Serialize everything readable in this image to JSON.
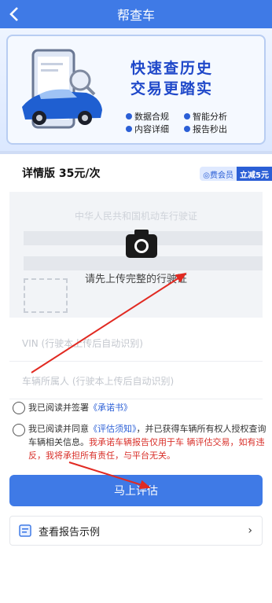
{
  "header": {
    "title": "帮查车"
  },
  "banner": {
    "slogan_line1": "快速查历史",
    "slogan_line2": "交易更踏实",
    "features": [
      "数据合规",
      "智能分析",
      "内容详细",
      "报告秒出"
    ],
    "colors": {
      "accent": "#2b5fd6",
      "highlight": "#e03a2f"
    }
  },
  "pricing": {
    "label": "详情版 35元/次",
    "vip_left": "◎费会员",
    "vip_right": "立减5元"
  },
  "upload": {
    "ghost_title": "中华人民共和国机动车行驶证",
    "tip": "请先上传完整的行驶证",
    "camera_icon": "camera-icon"
  },
  "fields": {
    "vin_placeholder": "VIN (行驶本上传后自动识别)",
    "owner_placeholder": "车辆所属人 (行驶本上传后自动识别)"
  },
  "agreements": {
    "a1_prefix": "我已阅读并签署",
    "a1_link": "《承诺书》",
    "a2_prefix": "我已阅读并同意",
    "a2_link": "《评估须知》",
    "a2_text": "，并已获得车辆所有权人授权查询车辆相关信息。",
    "a2_warning": "我承诺车辆报告仅用于车 辆评估交易，如有违反，我将承担所有责任，与平台无关。"
  },
  "submit": {
    "label": "马上评估"
  },
  "sample": {
    "label": "查看报告示例",
    "chevron": "›"
  }
}
